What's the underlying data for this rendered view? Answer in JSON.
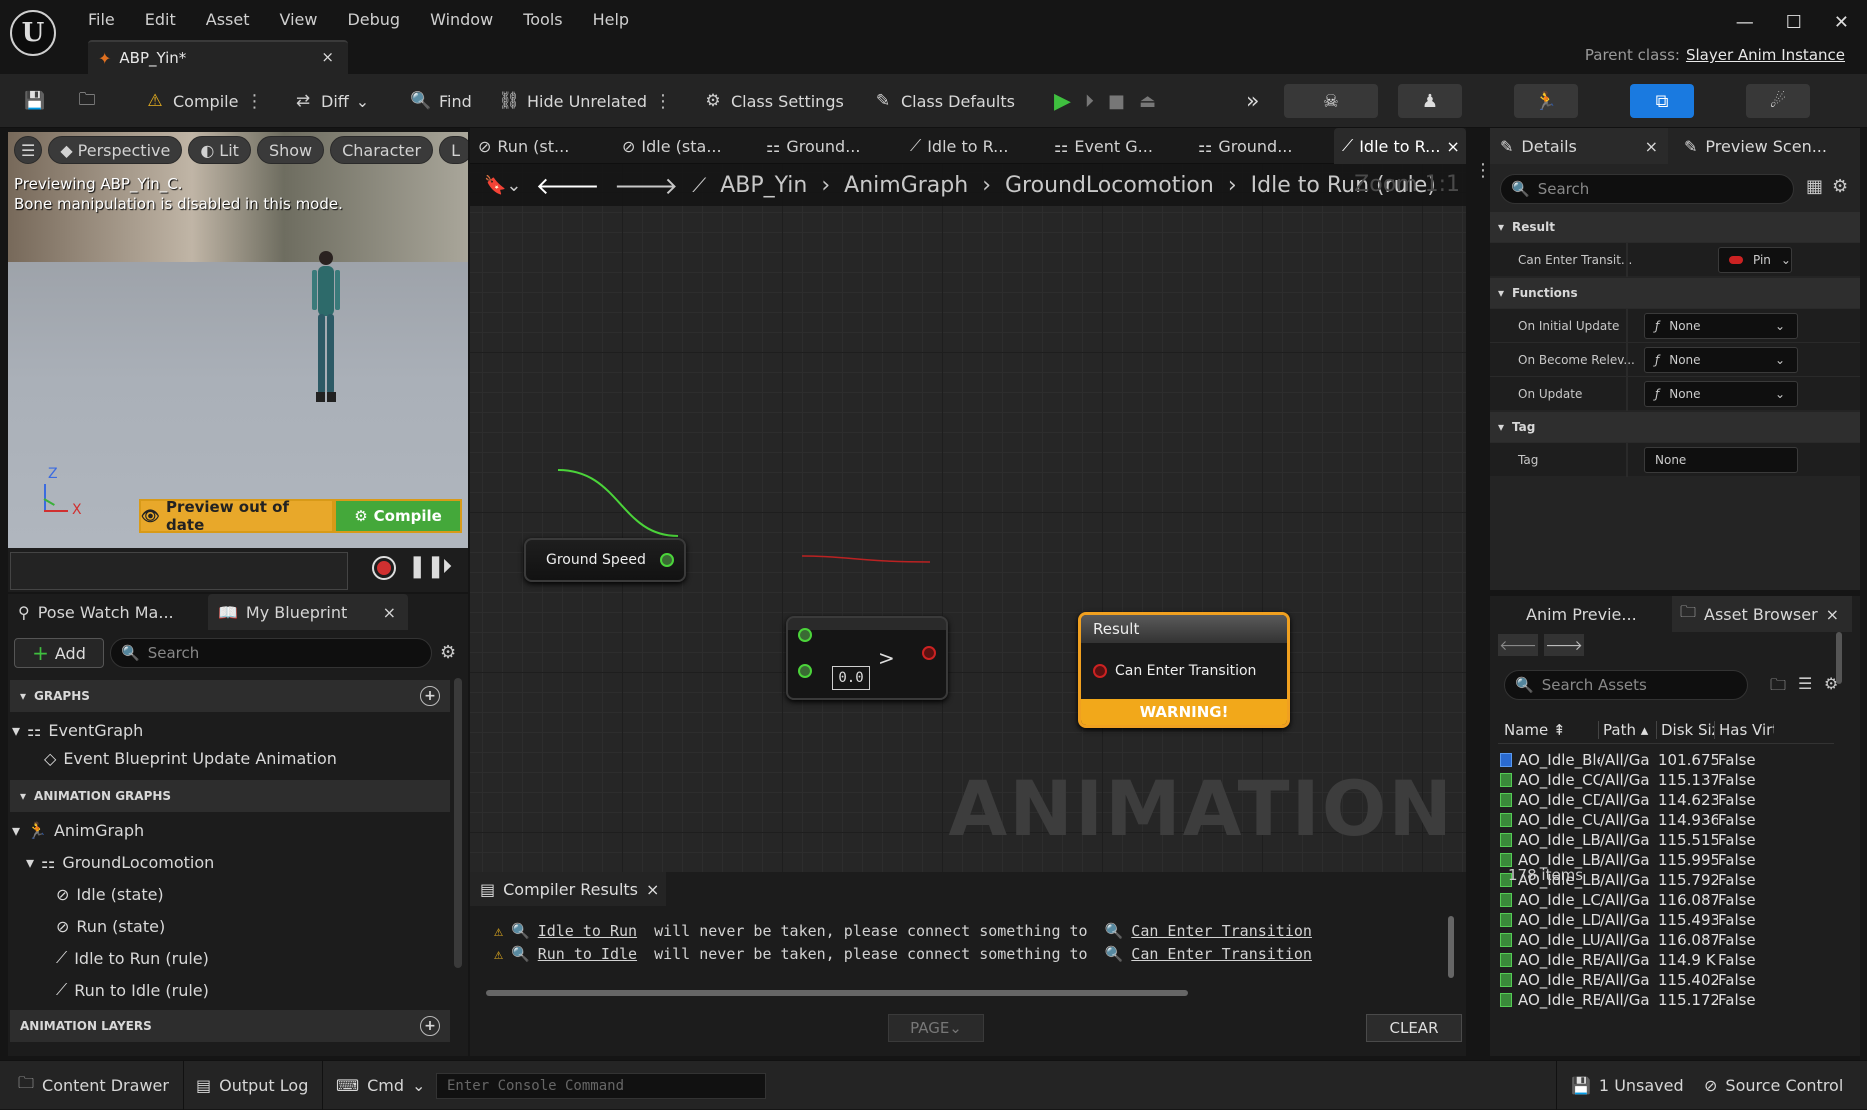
{
  "app": {
    "logo_letter": "U"
  },
  "menu": [
    "File",
    "Edit",
    "Asset",
    "View",
    "Debug",
    "Window",
    "Tools",
    "Help"
  ],
  "doc_tab": {
    "title": "ABP_Yin*",
    "close": "×"
  },
  "window_controls": {
    "minimize": "—",
    "maximize": "☐",
    "close": "✕"
  },
  "parent_class": {
    "label": "Parent class:",
    "value": "Slayer Anim Instance"
  },
  "toolbar": {
    "compile": "Compile",
    "diff": "Diff",
    "find": "Find",
    "hide_unrelated": "Hide Unrelated",
    "class_settings": "Class Settings",
    "class_defaults": "Class Defaults"
  },
  "viewport": {
    "perspective": "Perspective",
    "lit": "Lit",
    "show": "Show",
    "character": "Character",
    "more": "L",
    "message_line1": "Previewing ABP_Yin_C.",
    "message_line2": "Bone manipulation is disabled in this mode.",
    "axis_z": "Z",
    "axis_x": "X",
    "preview_out_of_date": "Preview out of date",
    "compile": "Compile"
  },
  "left_panel": {
    "tab_pose_watch": "Pose Watch Ma...",
    "tab_my_blueprint": "My Blueprint",
    "close": "×",
    "add": "Add",
    "search_placeholder": "Search",
    "sections": {
      "graphs": "GRAPHS",
      "anim_graphs": "ANIMATION GRAPHS",
      "anim_layers": "ANIMATION LAYERS"
    },
    "tree": {
      "event_graph": "EventGraph",
      "event_update": "Event Blueprint Update Animation",
      "anim_graph": "AnimGraph",
      "ground_locomotion": "GroundLocomotion",
      "idle_state": "Idle (state)",
      "run_state": "Run (state)",
      "idle_to_run": "Idle to Run (rule)",
      "run_to_idle": "Run to Idle (rule)"
    }
  },
  "graph_tabs": [
    "Run (st...",
    "Idle (sta...",
    "Ground...",
    "Idle to R...",
    "Event G...",
    "Ground...",
    "Idle to R..."
  ],
  "graph_tab_close": "×",
  "breadcrumb": [
    "ABP_Yin",
    "AnimGraph",
    "GroundLocomotion",
    "Idle to Run (rule)"
  ],
  "zoom": "Zoom 1:1",
  "watermark": "ANIMATION",
  "nodes": {
    "ground_speed": "Ground Speed",
    "compare_value": "0.0",
    "compare_op": ">",
    "result_title": "Result",
    "result_pin": "Can Enter Transition",
    "result_warning": "WARNING!"
  },
  "compiler": {
    "tab": "Compiler Results",
    "close": "×",
    "lines": [
      {
        "link1": "Idle to Run",
        "text": " will never be taken, please connect something to ",
        "link2": "Can Enter Transition"
      },
      {
        "link1": "Run to Idle",
        "text": " will never be taken, please connect something to ",
        "link2": "Can Enter Transition"
      }
    ],
    "page": "PAGE",
    "clear": "CLEAR"
  },
  "details": {
    "tab_details": "Details",
    "tab_preview": "Preview Scen...",
    "close": "×",
    "search_placeholder": "Search",
    "sections": {
      "result": "Result",
      "functions": "Functions",
      "tag": "Tag"
    },
    "rows": {
      "can_enter": "Can Enter Transit...",
      "pin": "Pin",
      "on_initial_update": "On Initial Update",
      "on_become_relevant": "On Become Relev...",
      "on_update": "On Update",
      "none": "None",
      "tag": "Tag"
    }
  },
  "assets": {
    "tab_anim_preview": "Anim Previe...",
    "tab_asset_browser": "Asset Browser",
    "close": "×",
    "search_placeholder": "Search Assets",
    "headers": {
      "name": "Name",
      "path": "Path",
      "disk_size": "Disk Size",
      "has_virtual": "Has Virtu"
    },
    "rows": [
      {
        "name": "AO_Idle_Ble",
        "path": "/All/Ga",
        "size": "101.675",
        "virt": "False"
      },
      {
        "name": "AO_Idle_CC",
        "path": "/All/Ga",
        "size": "115.137",
        "virt": "False"
      },
      {
        "name": "AO_Idle_CD",
        "path": "/All/Ga",
        "size": "114.623",
        "virt": "False"
      },
      {
        "name": "AO_Idle_CU",
        "path": "/All/Ga",
        "size": "114.936",
        "virt": "False"
      },
      {
        "name": "AO_Idle_LB",
        "path": "/All/Ga",
        "size": "115.515",
        "virt": "False"
      },
      {
        "name": "AO_Idle_LB",
        "path": "/All/Ga",
        "size": "115.995",
        "virt": "False"
      },
      {
        "name": "AO_Idle_LB",
        "path": "/All/Ga",
        "size": "115.792",
        "virt": "False"
      },
      {
        "name": "AO_Idle_LC",
        "path": "/All/Ga",
        "size": "116.087",
        "virt": "False"
      },
      {
        "name": "AO_Idle_LD",
        "path": "/All/Ga",
        "size": "115.493",
        "virt": "False"
      },
      {
        "name": "AO_Idle_LU",
        "path": "/All/Ga",
        "size": "116.087",
        "virt": "False"
      },
      {
        "name": "AO_Idle_RB",
        "path": "/All/Ga",
        "size": "114.9 K",
        "virt": "False"
      },
      {
        "name": "AO_Idle_RB",
        "path": "/All/Ga",
        "size": "115.402",
        "virt": "False"
      },
      {
        "name": "AO_Idle_RB",
        "path": "/All/Ga",
        "size": "115.172",
        "virt": "False"
      }
    ],
    "count": "178 items"
  },
  "statusbar": {
    "content_drawer": "Content Drawer",
    "output_log": "Output Log",
    "cmd": "Cmd",
    "console_placeholder": "Enter Console Command",
    "unsaved": "1 Unsaved",
    "source_control": "Source Control"
  }
}
